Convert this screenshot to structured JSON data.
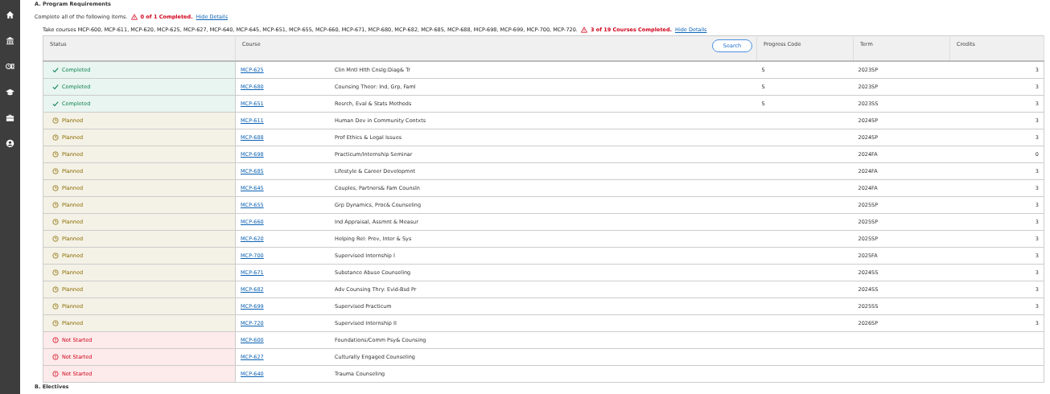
{
  "sidebar": {
    "items": [
      {
        "kind": "home"
      },
      {
        "kind": "bank"
      },
      {
        "kind": "money"
      },
      {
        "kind": "cap"
      },
      {
        "kind": "briefcase"
      },
      {
        "kind": "user"
      }
    ]
  },
  "section": {
    "title": "A.  Program Requirements",
    "summary": {
      "text": "Complete all of the following items.",
      "status": "0 of 1 Completed.",
      "link": "Hide Details"
    },
    "requirement": {
      "text": "Take courses MCP-600, MCP-611, MCP-620, MCP-625, MCP-627, MCP-640, MCP-645, MCP-651, MCP-655, MCP-660, MCP-671, MCP-680, MCP-682, MCP-685, MCP-688, MCP-698, MCP-699, MCP-700, MCP-720.",
      "status": "3 of 19 Courses Completed.",
      "link": "Hide Details"
    },
    "table": {
      "columns": [
        "Status",
        "Course",
        "Progress Code",
        "Term",
        "Credits"
      ],
      "search_button": "Search",
      "rows": [
        {
          "kind": "completed",
          "status": "Completed",
          "code": "MCP-625",
          "title": "Clin Mntl Hlth Cnslg:Diag& Tr",
          "progress": "S",
          "term": "2023SP",
          "credits": "3"
        },
        {
          "kind": "completed",
          "status": "Completed",
          "code": "MCP-680",
          "title": "Counsing Theor: Ind, Grp, Faml",
          "progress": "S",
          "term": "2023SP",
          "credits": "3"
        },
        {
          "kind": "completed",
          "status": "Completed",
          "code": "MCP-651",
          "title": "Resrch, Eval & Stats Methods",
          "progress": "S",
          "term": "2023SS",
          "credits": "3"
        },
        {
          "kind": "planned",
          "status": "Planned",
          "code": "MCP-611",
          "title": "Human Dev in Community Contxts",
          "term": "2024SP",
          "credits": "3"
        },
        {
          "kind": "planned",
          "status": "Planned",
          "code": "MCP-688",
          "title": "Prof Ethics & Legal Issues",
          "term": "2024SP",
          "credits": "3"
        },
        {
          "kind": "planned",
          "status": "Planned",
          "code": "MCP-698",
          "title": "Practicum/Internship Seminar",
          "term": "2024FA",
          "credits": "0"
        },
        {
          "kind": "planned",
          "status": "Planned",
          "code": "MCP-685",
          "title": "Lifestyle & Career Developmnt",
          "term": "2024FA",
          "credits": "3"
        },
        {
          "kind": "planned",
          "status": "Planned",
          "code": "MCP-645",
          "title": "Couples, Partners& Fam Counsln",
          "term": "2024FA",
          "credits": "3"
        },
        {
          "kind": "planned",
          "status": "Planned",
          "code": "MCP-655",
          "title": "Grp Dynamics, Proc& Counseling",
          "term": "2025SP",
          "credits": "3"
        },
        {
          "kind": "planned",
          "status": "Planned",
          "code": "MCP-660",
          "title": "Ind Appraisal, Assmnt & Measur",
          "term": "2025SP",
          "credits": "3"
        },
        {
          "kind": "planned",
          "status": "Planned",
          "code": "MCP-620",
          "title": "Helping Rel: Prev, Inter & Sys",
          "term": "2025SP",
          "credits": "3"
        },
        {
          "kind": "planned",
          "status": "Planned",
          "code": "MCP-700",
          "title": "Supervised Internship I",
          "term": "2025FA",
          "credits": "3"
        },
        {
          "kind": "planned",
          "status": "Planned",
          "code": "MCP-671",
          "title": "Substance Abuse Counseling",
          "term": "2024SS",
          "credits": "3"
        },
        {
          "kind": "planned",
          "status": "Planned",
          "code": "MCP-682",
          "title": "Adv Counsing Thry: Evid-Bsd Pr",
          "term": "2024SS",
          "credits": "3"
        },
        {
          "kind": "planned",
          "status": "Planned",
          "code": "MCP-699",
          "title": "Supervised Practicum",
          "term": "2025SS",
          "credits": "3"
        },
        {
          "kind": "planned",
          "status": "Planned",
          "code": "MCP-720",
          "title": "Supervised Internship II",
          "term": "2026SP",
          "credits": "3"
        },
        {
          "kind": "not_started",
          "status": "Not Started",
          "code": "MCP-600",
          "title": "Foundations/Comm Psy& Counsing"
        },
        {
          "kind": "not_started",
          "status": "Not Started",
          "code": "MCP-627",
          "title": "Culturally Engaged Counseling"
        },
        {
          "kind": "not_started",
          "status": "Not Started",
          "code": "MCP-640",
          "title": "Trauma Counseling"
        }
      ]
    }
  },
  "next_section": {
    "title": "B.  Electives"
  }
}
